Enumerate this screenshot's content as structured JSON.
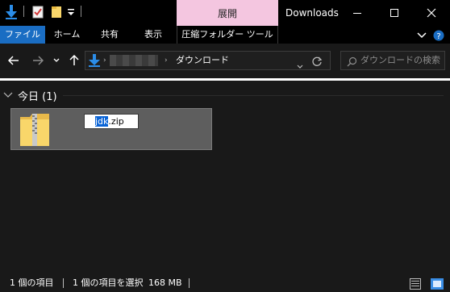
{
  "window": {
    "title": "Downloads",
    "manage_tab": "展開"
  },
  "ribbon": {
    "tabs": [
      "ファイル",
      "ホーム",
      "共有",
      "表示",
      "圧縮フォルダー ツール"
    ]
  },
  "address": {
    "current_folder": "ダウンロード",
    "search_placeholder": "ダウンロードの検索"
  },
  "content": {
    "group_title": "今日 (1)",
    "file": {
      "name_selected": "jdk",
      "name_rest": ".zip"
    }
  },
  "status": {
    "item_count": "1 個の項目",
    "selected": "1 個の項目を選択",
    "size": "168 MB"
  },
  "colors": {
    "manage_tab_bg": "#f4c6e0",
    "file_tab_bg": "#1a6dc3",
    "selection_bg": "#0a64d6"
  }
}
